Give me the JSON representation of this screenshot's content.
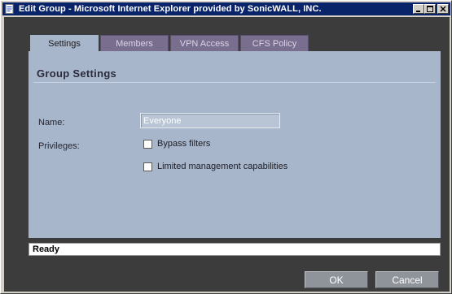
{
  "window": {
    "title": "Edit Group - Microsoft Internet Explorer provided by SonicWALL, INC.",
    "icons": {
      "app": "ie-page-icon",
      "minimize": "minimize-icon",
      "maximize": "maximize-icon",
      "close": "close-icon"
    }
  },
  "tabs": [
    {
      "label": "Settings",
      "active": true
    },
    {
      "label": "Members",
      "active": false
    },
    {
      "label": "VPN Access",
      "active": false
    },
    {
      "label": "CFS Policy",
      "active": false
    }
  ],
  "panel": {
    "section_title": "Group Settings",
    "name_label": "Name:",
    "name_value": "Everyone",
    "privileges_label": "Privileges:",
    "privileges": [
      {
        "label": "Bypass filters",
        "checked": false
      },
      {
        "label": "Limited management capabilities",
        "checked": false
      }
    ]
  },
  "status": {
    "text": "Ready"
  },
  "buttons": {
    "ok": "OK",
    "cancel": "Cancel"
  },
  "colors": {
    "titlebar": "#0a246a",
    "tab_inactive": "#7a6e8e",
    "panel": "#a8b6cb",
    "button": "#8f939a",
    "background": "#3c3c3c"
  }
}
